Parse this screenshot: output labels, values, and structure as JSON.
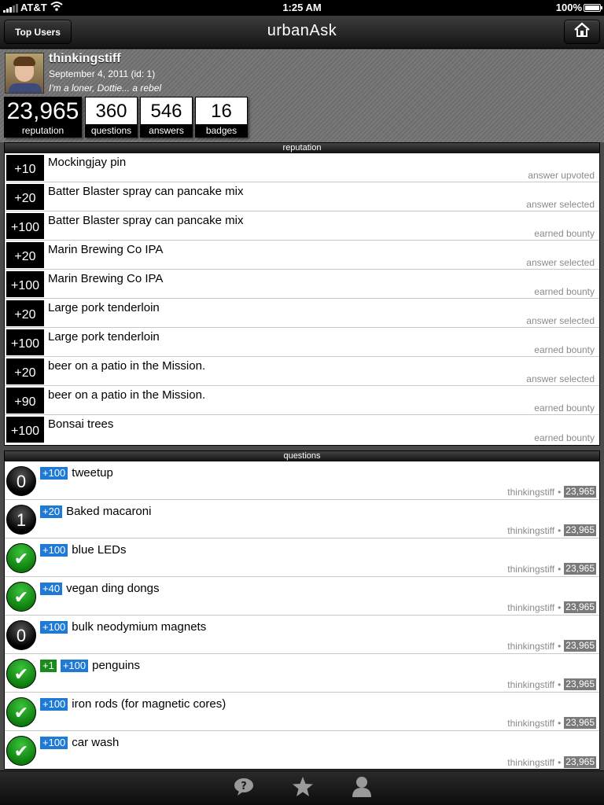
{
  "status_bar": {
    "carrier": "AT&T",
    "time": "1:25 AM",
    "battery": "100%",
    "signal_icon": "signal-bars-icon",
    "wifi_icon": "wifi-icon",
    "battery_icon": "battery-icon"
  },
  "nav": {
    "back_label": "Top Users",
    "title": "urbanAsk",
    "home_icon": "home-icon"
  },
  "profile": {
    "username": "thinkingstiff",
    "joined": "September 4, 2011 (id: 1)",
    "bio": "I'm a loner, Dottie... a rebel",
    "stats": {
      "reputation": {
        "value": "23,965",
        "label": "reputation"
      },
      "questions": {
        "value": "360",
        "label": "questions"
      },
      "answers": {
        "value": "546",
        "label": "answers"
      },
      "badges": {
        "value": "16",
        "label": "badges"
      }
    }
  },
  "reputation": {
    "header": "reputation",
    "items": [
      {
        "points": "+10",
        "title": "Mockingjay pin",
        "event": "answer upvoted"
      },
      {
        "points": "+20",
        "title": "Batter Blaster spray can pancake mix",
        "event": "answer selected"
      },
      {
        "points": "+100",
        "title": "Batter Blaster spray can pancake mix",
        "event": "earned bounty"
      },
      {
        "points": "+20",
        "title": "Marin Brewing Co IPA",
        "event": "answer selected"
      },
      {
        "points": "+100",
        "title": "Marin Brewing Co IPA",
        "event": "earned bounty"
      },
      {
        "points": "+20",
        "title": "Large pork tenderloin",
        "event": "answer selected"
      },
      {
        "points": "+100",
        "title": "Large pork tenderloin",
        "event": "earned bounty"
      },
      {
        "points": "+20",
        "title": "beer on a patio in the Mission.",
        "event": "answer selected"
      },
      {
        "points": "+90",
        "title": "beer on a patio in the Mission.",
        "event": "earned bounty"
      },
      {
        "points": "+100",
        "title": "Bonsai trees",
        "event": "earned bounty"
      }
    ]
  },
  "questions": {
    "header": "questions",
    "separator": "•",
    "items": [
      {
        "status": "open",
        "answers": "0",
        "votes": "",
        "bounty": "+100",
        "title": "tweetup",
        "author": "thinkingstiff",
        "author_rep": "23,965"
      },
      {
        "status": "open",
        "answers": "1",
        "votes": "",
        "bounty": "+20",
        "title": "Baked macaroni",
        "author": "thinkingstiff",
        "author_rep": "23,965"
      },
      {
        "status": "answered",
        "answers": "✔",
        "votes": "",
        "bounty": "+100",
        "title": "blue LEDs",
        "author": "thinkingstiff",
        "author_rep": "23,965"
      },
      {
        "status": "answered",
        "answers": "✔",
        "votes": "",
        "bounty": "+40",
        "title": "vegan ding dongs",
        "author": "thinkingstiff",
        "author_rep": "23,965"
      },
      {
        "status": "open",
        "answers": "0",
        "votes": "",
        "bounty": "+100",
        "title": "bulk neodymium magnets",
        "author": "thinkingstiff",
        "author_rep": "23,965"
      },
      {
        "status": "answered",
        "answers": "✔",
        "votes": "+1",
        "bounty": "+100",
        "title": "penguins",
        "author": "thinkingstiff",
        "author_rep": "23,965"
      },
      {
        "status": "answered",
        "answers": "✔",
        "votes": "",
        "bounty": "+100",
        "title": "iron rods (for magnetic cores)",
        "author": "thinkingstiff",
        "author_rep": "23,965"
      },
      {
        "status": "answered",
        "answers": "✔",
        "votes": "",
        "bounty": "+100",
        "title": "car wash",
        "author": "thinkingstiff",
        "author_rep": "23,965"
      }
    ]
  },
  "tab_bar": {
    "tabs": [
      "question-icon",
      "star-icon",
      "user-icon"
    ]
  }
}
